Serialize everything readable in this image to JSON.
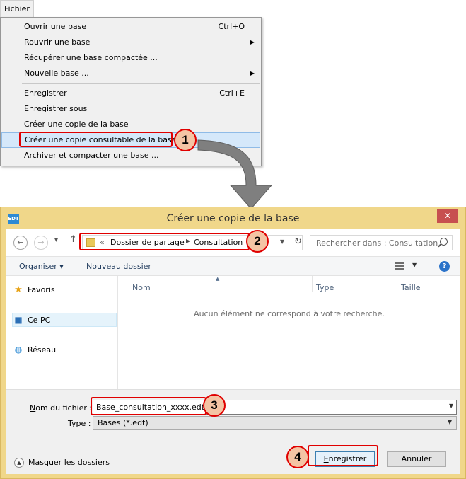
{
  "menubar": {
    "fichier_label": "Fichier"
  },
  "menu": {
    "items": [
      {
        "label": "Ouvrir une base",
        "shortcut": "Ctrl+O"
      },
      {
        "label": "Rouvrir une base",
        "submenu_arrow": "▶"
      },
      {
        "label": "Récupérer une base compactée ..."
      },
      {
        "label": "Nouvelle base ...",
        "submenu_arrow": "▶"
      },
      {
        "label": "Enregistrer",
        "shortcut": "Ctrl+E"
      },
      {
        "label": "Enregistrer sous"
      },
      {
        "label": "Créer une copie de la base"
      },
      {
        "label": "Créer une copie consultable de la base"
      },
      {
        "label": "Archiver et compacter une base ..."
      }
    ]
  },
  "steps": {
    "one": "1",
    "two": "2",
    "three": "3",
    "four": "4"
  },
  "dialog": {
    "icon_text": "EDT",
    "title": "Créer une copie de la base",
    "close_glyph": "✕",
    "nav": {
      "back": "←",
      "forward": "→",
      "recent": "▾",
      "up": "↑"
    },
    "address": {
      "chevron": "«",
      "crumbs": [
        "Dossier de partage",
        "Consultation"
      ],
      "crumb_sep": "▶",
      "drop": "▼",
      "refresh": "↻"
    },
    "search_placeholder": "Rechercher dans : Consultation",
    "toolbar": {
      "organiser": "Organiser ▾",
      "nouveau_dossier": "Nouveau dossier",
      "view_drop": "▼",
      "help": "?"
    },
    "navpane": {
      "favoris": "Favoris",
      "ce_pc": "Ce PC",
      "reseau": "Réseau"
    },
    "columns": {
      "nom": "Nom",
      "type": "Type",
      "taille": "Taille",
      "sort_glyph": "▲"
    },
    "empty_message": "Aucun élément ne correspond à votre recherche.",
    "file_name_label_u": "N",
    "file_name_label_rest": "om du fichier :",
    "file_name_value": "Base_consultation_xxxx.edt",
    "type_label_u": "T",
    "type_label_rest": "ype :",
    "type_value": "Bases (*.edt)",
    "dropdown_glyph": "▼",
    "hide_folders_glyph": "▲",
    "hide_folders": "Masquer les dossiers",
    "save_u": "E",
    "save_rest": "nregistrer",
    "cancel": "Annuler"
  },
  "colors": {
    "highlight": "#e00000",
    "badge_fill": "#f4c4a4",
    "dialog_frame": "#f0d78a",
    "arrow": "#7f7f7f"
  }
}
